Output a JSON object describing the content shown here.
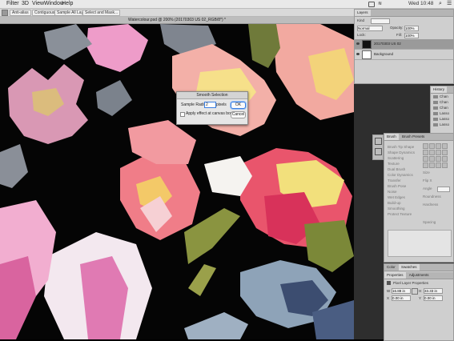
{
  "menubar": {
    "items": [
      "Filter",
      "3D",
      "View",
      "Window",
      "Help"
    ],
    "status": "Wed 10:48"
  },
  "options": {
    "chips": [
      "Anti-alias",
      "Contiguous",
      "Sample All Layers",
      "Select and Mask..."
    ]
  },
  "document": {
    "tab_title": "Watercolour.psd @ 200% (20170303 US 02_RGB/8*) *"
  },
  "dialog": {
    "title": "Smooth Selection",
    "radius_label": "Sample Radius:",
    "radius_value": "2",
    "units": "pixels",
    "canvas_bounds_label": "Apply effect at canvas bounds",
    "ok_label": "OK",
    "cancel_label": "Cancel"
  },
  "layers_panel": {
    "tab": "Layers",
    "kind": "Kind",
    "blend_mode": "Normal",
    "opacity_label": "Opacity:",
    "opacity_value": "100%",
    "lock_label": "Lock:",
    "fill_label": "Fill:",
    "fill_value": "100%",
    "layers": [
      {
        "name": "20170303 US 02",
        "selected": true
      },
      {
        "name": "Background",
        "selected": false
      }
    ]
  },
  "history_panel": {
    "tab": "History",
    "items": [
      "Chan",
      "Chan",
      "Chan",
      "Lasso",
      "Lasso",
      "Lasso"
    ]
  },
  "brush_panel": {
    "tabs": [
      "Brush",
      "Brush Presets"
    ],
    "options": [
      "Brush Tip Shape",
      "Shape Dynamics",
      "Scattering",
      "Texture",
      "Dual Brush",
      "Color Dynamics",
      "Transfer",
      "Brush Pose",
      "Noise",
      "Wet Edges",
      "Build-up",
      "Smoothing",
      "Protect Texture"
    ],
    "labels": [
      "Size",
      "Flip X",
      "Angle",
      "Roundness",
      "Hardness",
      "Spacing"
    ]
  },
  "bottom_panel": {
    "tabs": [
      "Color",
      "Swatches"
    ],
    "subtabs": [
      "Properties",
      "Adjustments"
    ],
    "title": "Pixel Layer Properties",
    "w_label": "W",
    "w_value": "16.88 in",
    "h_label": "H",
    "h_value": "33.33 in",
    "x_label": "X",
    "x_value": "0.00 in",
    "y_label": "Y",
    "y_value": "0.00 in"
  },
  "colors": {
    "canvas_bg": "#050505",
    "panel_bg": "#cfcfcf",
    "accent": "#3a7ee0"
  }
}
